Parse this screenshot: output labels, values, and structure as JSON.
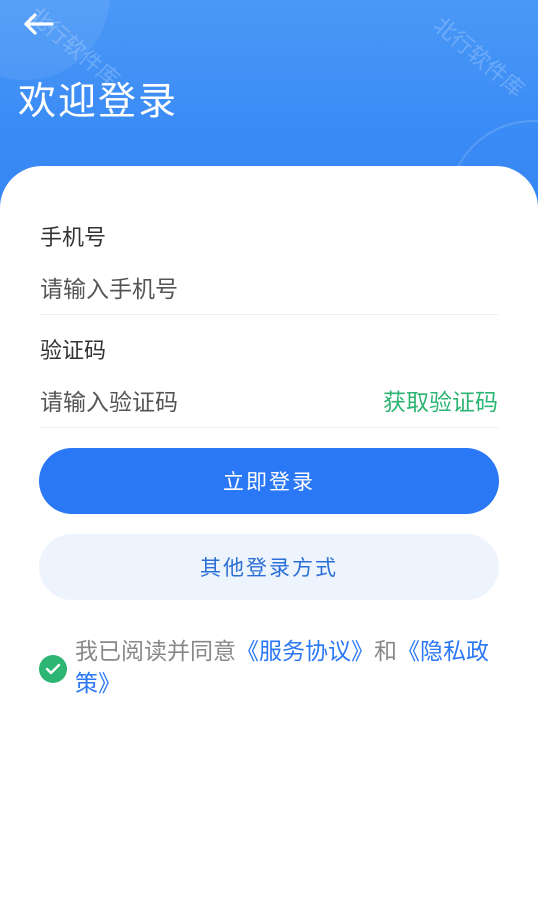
{
  "header": {
    "title": "欢迎登录",
    "back_icon": "back-arrow-icon",
    "watermark": "北行软件库"
  },
  "form": {
    "phone_label": "手机号",
    "phone_placeholder": "请输入手机号",
    "code_label": "验证码",
    "code_placeholder": "请输入验证码",
    "get_code_label": "获取验证码"
  },
  "buttons": {
    "login_label": "立即登录",
    "other_login_label": "其他登录方式"
  },
  "agreement": {
    "prefix": "我已阅读并同意",
    "service_link": "《服务协议》",
    "conjunction": "和",
    "privacy_link": "《隐私政策》",
    "checked": true
  },
  "colors": {
    "primary": "#2b78f6",
    "header": "#3b8cf5",
    "success": "#2cb573",
    "secondary_bg": "#edf4fe"
  }
}
